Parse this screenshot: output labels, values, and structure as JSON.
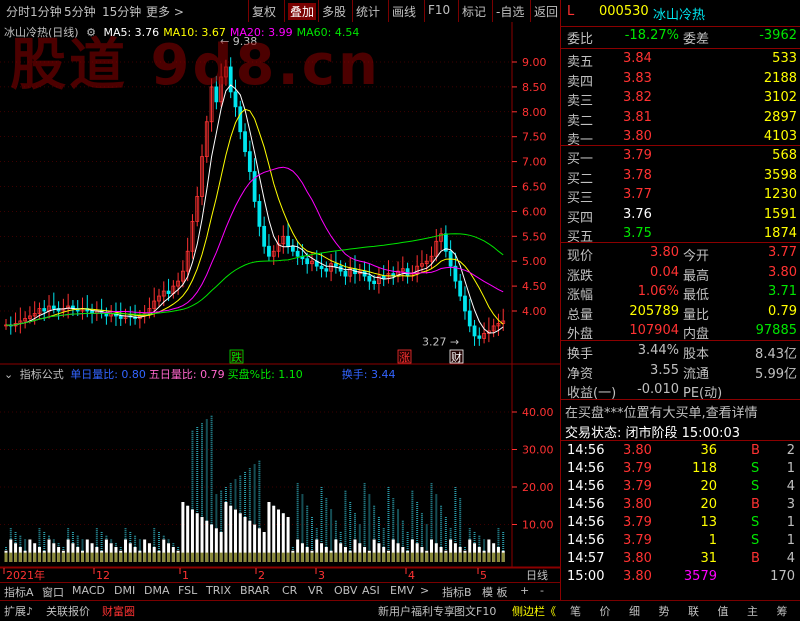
{
  "toolbar": {
    "items": [
      "分时",
      "1分钟",
      "5分钟",
      "15分钟",
      "更多 >",
      "复权",
      "叠加",
      "多股",
      "统计",
      "画线",
      "F10",
      "标记",
      "-自选",
      "返回"
    ],
    "active": "叠加"
  },
  "chart": {
    "title": "冰山冷热(日线)",
    "ma": [
      {
        "label": "MA5: 3.76",
        "color": "#ffffff"
      },
      {
        "label": "MA10: 3.67",
        "color": "#ffff00"
      },
      {
        "label": "MA20: 3.99",
        "color": "#ff00ff"
      },
      {
        "label": "MA60: 4.54",
        "color": "#00e600"
      }
    ],
    "high_label": "9.38",
    "low_label": "3.27",
    "price_ticks": [
      "9.00",
      "8.50",
      "8.00",
      "7.50",
      "7.00",
      "6.50",
      "6.00",
      "5.50",
      "5.00",
      "4.50",
      "4.00"
    ],
    "markers": [
      {
        "label": "跌",
        "color": "#00e600"
      },
      {
        "label": "涨",
        "color": "#ff3232"
      },
      {
        "label": "财",
        "color": "#ffffff"
      }
    ],
    "date_labels": [
      "2021年",
      "12",
      "1",
      "2",
      "3",
      "4",
      "5"
    ],
    "period": "日线",
    "watermark": "股道 9d8.cn"
  },
  "indicator": {
    "name": "指标公式",
    "items": [
      {
        "label": "单日量比: 0.80",
        "color": "#3264ff"
      },
      {
        "label": "五日量比: 0.79",
        "color": "#ff66cc"
      },
      {
        "label": "买盘%比: 1.10",
        "color": "#00e600"
      },
      {
        "label": "换手: 3.44",
        "color": "#3264ff"
      }
    ],
    "ticks": [
      "40.00",
      "30.00",
      "20.00",
      "10.00"
    ]
  },
  "bottom_tabs": [
    "指标A",
    "窗口",
    "MACD",
    "DMI",
    "DMA",
    "FSL",
    "TRIX",
    "BRAR",
    "CR",
    "VR",
    "OBV",
    "ASI",
    "EMV",
    ">",
    "指标B",
    "模 板",
    "+",
    "-"
  ],
  "status": {
    "left": [
      "扩展♪",
      "关联报价",
      "财富圈"
    ],
    "right": [
      "新用户福利专享",
      "图文F10",
      "侧边栏《"
    ],
    "right_tabs": [
      "笔",
      "价",
      "细",
      "势",
      "联",
      "值",
      "主",
      "筹"
    ]
  },
  "quote": {
    "flag": "L",
    "code": "000530",
    "name": "冰山冷热",
    "wei_bi_label": "委比",
    "wei_bi": "-18.27%",
    "wei_cha_label": "委差",
    "wei_cha": "-3962",
    "asks": [
      {
        "label": "卖五",
        "price": "3.84",
        "vol": "533"
      },
      {
        "label": "卖四",
        "price": "3.83",
        "vol": "2188"
      },
      {
        "label": "卖三",
        "price": "3.82",
        "vol": "3102"
      },
      {
        "label": "卖二",
        "price": "3.81",
        "vol": "2897"
      },
      {
        "label": "卖一",
        "price": "3.80",
        "vol": "4103"
      }
    ],
    "bids": [
      {
        "label": "买一",
        "price": "3.79",
        "vol": "568",
        "pc": "#ff3232"
      },
      {
        "label": "买二",
        "price": "3.78",
        "vol": "3598",
        "pc": "#ff3232"
      },
      {
        "label": "买三",
        "price": "3.77",
        "vol": "1230",
        "pc": "#ff3232"
      },
      {
        "label": "买四",
        "price": "3.76",
        "vol": "1591",
        "pc": "#ffffff"
      },
      {
        "label": "买五",
        "price": "3.75",
        "vol": "1874",
        "pc": "#00e600"
      }
    ],
    "stats": [
      {
        "l1": "现价",
        "v1": "3.80",
        "c1": "#ff3232",
        "l2": "今开",
        "v2": "3.77",
        "c2": "#ff3232"
      },
      {
        "l1": "涨跌",
        "v1": "0.04",
        "c1": "#ff3232",
        "l2": "最高",
        "v2": "3.80",
        "c2": "#ff3232"
      },
      {
        "l1": "涨幅",
        "v1": "1.06%",
        "c1": "#ff3232",
        "l2": "最低",
        "v2": "3.71",
        "c2": "#00e600"
      },
      {
        "l1": "总量",
        "v1": "205789",
        "c1": "#ffff00",
        "l2": "量比",
        "v2": "0.79",
        "c2": "#ffff00"
      },
      {
        "l1": "外盘",
        "v1": "107904",
        "c1": "#ff3232",
        "l2": "内盘",
        "v2": "97885",
        "c2": "#00e600"
      }
    ],
    "stats2": [
      {
        "l1": "换手",
        "v1": "3.44%",
        "c1": "#c0c0c0",
        "l2": "股本",
        "v2": "8.43亿",
        "c2": "#c0c0c0"
      },
      {
        "l1": "净资",
        "v1": "3.55",
        "c1": "#c0c0c0",
        "l2": "流通",
        "v2": "5.99亿",
        "c2": "#c0c0c0"
      },
      {
        "l1": "收益(一)",
        "v1": "-0.010",
        "c1": "#c0c0c0",
        "l2": "PE(动)",
        "v2": "",
        "c2": "#c0c0c0"
      }
    ],
    "notice": "在买盘***位置有大买单,查看详情",
    "trade_state": "交易状态: 闭市阶段  15:00:03",
    "ticks": [
      {
        "t": "14:56",
        "p": "3.80",
        "pc": "#ff3232",
        "v": "36",
        "vc": "#ffff00",
        "s": "B",
        "sc": "#ff3232",
        "n": "2"
      },
      {
        "t": "14:56",
        "p": "3.79",
        "pc": "#ff3232",
        "v": "118",
        "vc": "#ffff00",
        "s": "S",
        "sc": "#00e600",
        "n": "1"
      },
      {
        "t": "14:56",
        "p": "3.79",
        "pc": "#ff3232",
        "v": "20",
        "vc": "#ffff00",
        "s": "S",
        "sc": "#00e600",
        "n": "4"
      },
      {
        "t": "14:56",
        "p": "3.80",
        "pc": "#ff3232",
        "v": "20",
        "vc": "#ffff00",
        "s": "B",
        "sc": "#ff3232",
        "n": "3"
      },
      {
        "t": "14:56",
        "p": "3.79",
        "pc": "#ff3232",
        "v": "13",
        "vc": "#ffff00",
        "s": "S",
        "sc": "#00e600",
        "n": "1"
      },
      {
        "t": "14:56",
        "p": "3.79",
        "pc": "#ff3232",
        "v": "1",
        "vc": "#ffff00",
        "s": "S",
        "sc": "#00e600",
        "n": "1"
      },
      {
        "t": "14:57",
        "p": "3.80",
        "pc": "#ff3232",
        "v": "31",
        "vc": "#ffff00",
        "s": "B",
        "sc": "#ff3232",
        "n": "4"
      },
      {
        "t": "15:00",
        "p": "3.80",
        "pc": "#ff3232",
        "v": "3579",
        "vc": "#ff00ff",
        "s": "",
        "sc": "#c0c0c0",
        "n": "170"
      }
    ]
  }
}
